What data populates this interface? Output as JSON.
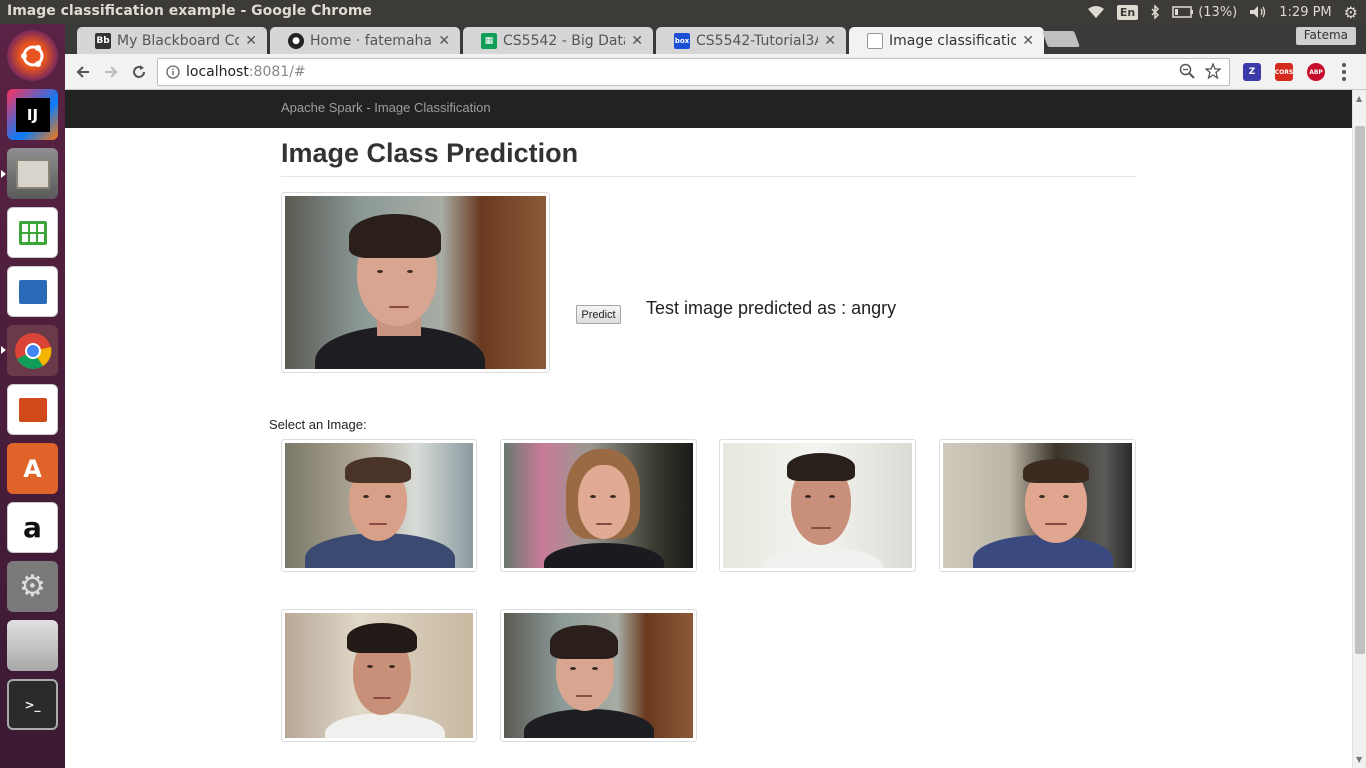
{
  "os": {
    "window_title": "Image classification example - Google Chrome",
    "indicators": {
      "language": "En",
      "battery": "(13%)",
      "clock": "1:29 PM"
    }
  },
  "launcher": {
    "items": [
      "ubuntu-dash",
      "intellij",
      "files",
      "libreoffice-calc",
      "libreoffice-writer",
      "chrome",
      "libreoffice-impress",
      "software-center",
      "amazon",
      "system-settings",
      "disk",
      "terminal"
    ]
  },
  "browser": {
    "profile_name": "Fatema",
    "tabs": [
      {
        "label": "My Blackboard Con",
        "icon": "blackboard-icon"
      },
      {
        "label": "Home · fatemahast",
        "icon": "github-icon"
      },
      {
        "label": "CS5542 - Big Data A",
        "icon": "sheets-icon"
      },
      {
        "label": "CS5542-Tutorial3A-I",
        "icon": "box-icon"
      },
      {
        "label": "Image classificatior",
        "icon": "page-icon",
        "active": true
      }
    ],
    "address": {
      "host": "localhost",
      "rest": ":8081/#"
    },
    "extensions": [
      "Z",
      "CORS",
      "ABP"
    ]
  },
  "page": {
    "brand": "Apache Spark - Image Classification",
    "title": "Image Class Prediction",
    "predict_button": "Predict",
    "prediction_text": "Test image predicted as : angry",
    "select_label": "Select an Image:"
  }
}
